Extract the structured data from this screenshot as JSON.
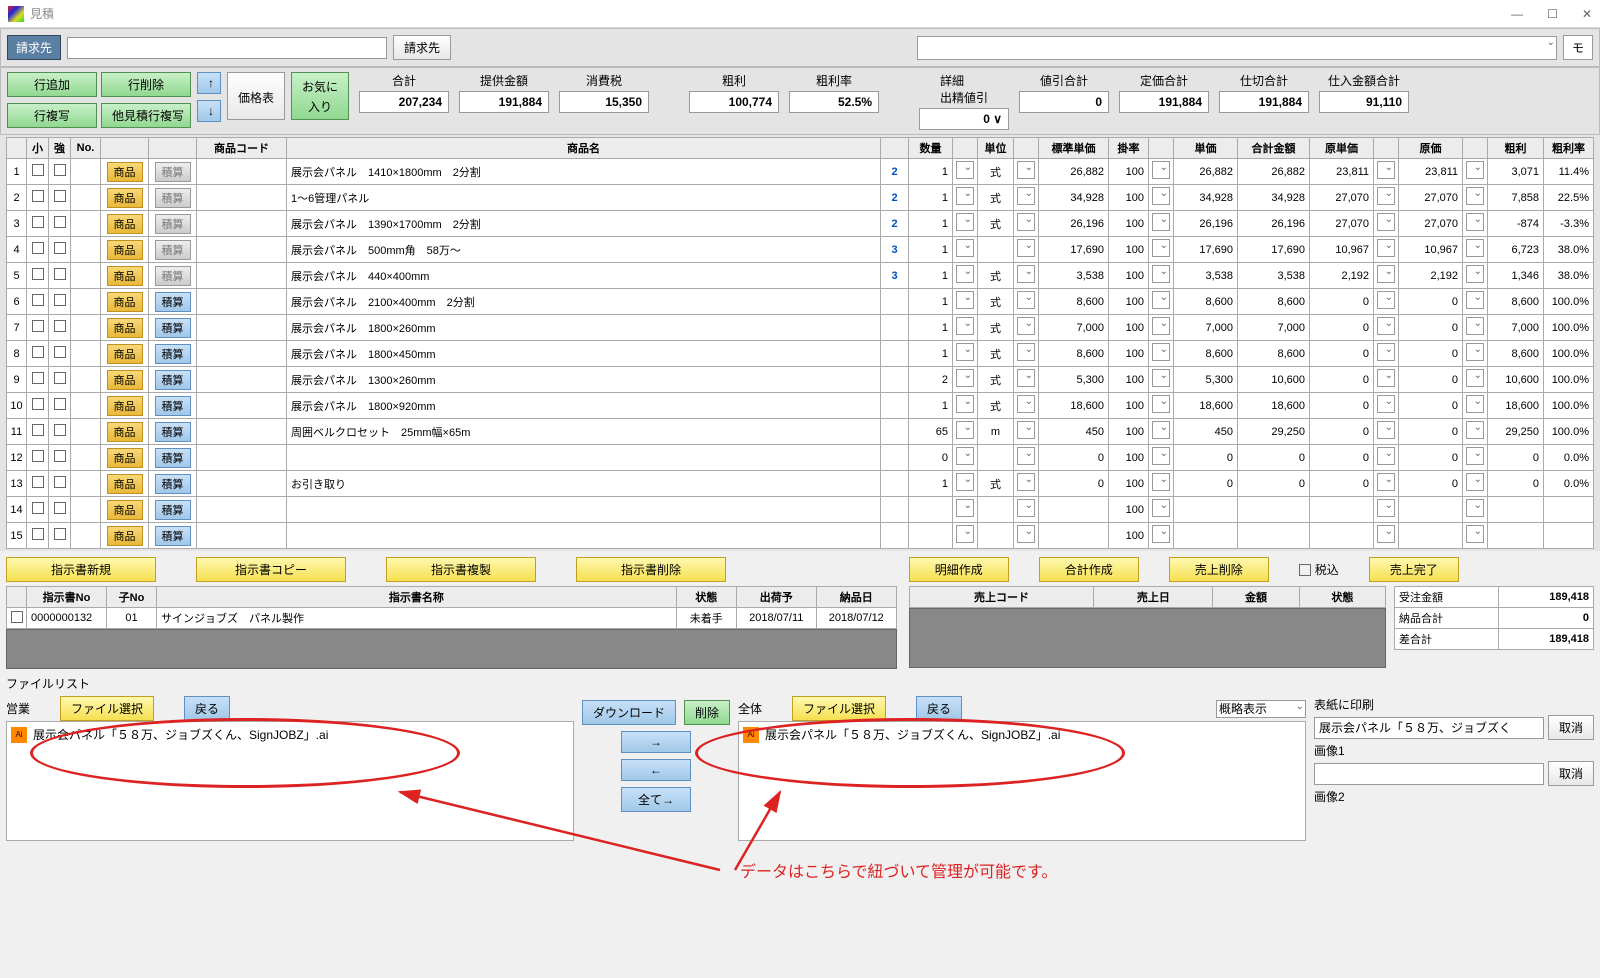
{
  "window": {
    "title": "見積",
    "min": "—",
    "max": "☐",
    "close": "✕"
  },
  "top": {
    "billing_btn": "請求先",
    "big_dropdown": "",
    "mo": "モ",
    "row_add": "行追加",
    "row_del": "行削除",
    "row_copy": "行複写",
    "other_copy": "他見積行複写",
    "up": "↑",
    "down": "↓",
    "price_table": "価格表",
    "favorite": "お気に\n入り"
  },
  "totals": {
    "sum_lbl": "合計",
    "offer_lbl": "提供金額",
    "tax_lbl": "消費税",
    "gp_lbl": "粗利",
    "gpr_lbl": "粗利率",
    "detail_lbl": "詳細",
    "detail2_lbl": "出精値引",
    "disc_lbl": "値引合計",
    "list_lbl": "定価合計",
    "cost_lbl": "仕切合計",
    "purchase_lbl": "仕入金額合計",
    "offer": "207,234",
    "offer2": "191,884",
    "tax": "15,350",
    "gp": "100,774",
    "gpr": "52.5%",
    "detail_val": "0 ∨",
    "disc": "0",
    "list": "191,884",
    "cost": "191,884",
    "purchase": "91,110"
  },
  "grid": {
    "headers": [
      "",
      "小",
      "強",
      "No.",
      "",
      "",
      "商品コード",
      "商品名",
      "",
      "数量",
      "",
      "単位",
      "",
      "標準単価",
      "掛率",
      "",
      "単価",
      "合計金額",
      "原単価",
      "",
      "原価",
      "",
      "粗利",
      "粗利率"
    ],
    "rows": [
      {
        "n": 1,
        "name": "展示会パネル　1410×1800mm　2分割",
        "link": "2",
        "qty": "1",
        "unit": "式",
        "stdp": "26,882",
        "rate": "100",
        "up": "26,882",
        "tot": "26,882",
        "cu": "23,811",
        "cost": "23,811",
        "gp": "3,071",
        "gpr": "11.4%",
        "calc": "gray"
      },
      {
        "n": 2,
        "name": "1～6管理パネル",
        "link": "2",
        "qty": "1",
        "unit": "式",
        "stdp": "34,928",
        "rate": "100",
        "up": "34,928",
        "tot": "34,928",
        "cu": "27,070",
        "cost": "27,070",
        "gp": "7,858",
        "gpr": "22.5%",
        "calc": "gray"
      },
      {
        "n": 3,
        "name": "展示会パネル　1390×1700mm　2分割",
        "link": "2",
        "qty": "1",
        "unit": "式",
        "stdp": "26,196",
        "rate": "100",
        "up": "26,196",
        "tot": "26,196",
        "cu": "27,070",
        "cost": "27,070",
        "gp": "-874",
        "gpr": "-3.3%",
        "calc": "gray"
      },
      {
        "n": 4,
        "name": "展示会パネル　500mm角　58万～",
        "link": "3",
        "qty": "1",
        "unit": "",
        "stdp": "17,690",
        "rate": "100",
        "up": "17,690",
        "tot": "17,690",
        "cu": "10,967",
        "cost": "10,967",
        "gp": "6,723",
        "gpr": "38.0%",
        "calc": "gray"
      },
      {
        "n": 5,
        "name": "展示会パネル　440×400mm",
        "link": "3",
        "qty": "1",
        "unit": "式",
        "stdp": "3,538",
        "rate": "100",
        "up": "3,538",
        "tot": "3,538",
        "cu": "2,192",
        "cost": "2,192",
        "gp": "1,346",
        "gpr": "38.0%",
        "calc": "gray"
      },
      {
        "n": 6,
        "name": "展示会パネル　2100×400mm　2分割",
        "link": "",
        "qty": "1",
        "unit": "式",
        "stdp": "8,600",
        "rate": "100",
        "up": "8,600",
        "tot": "8,600",
        "cu": "0",
        "cost": "0",
        "gp": "8,600",
        "gpr": "100.0%",
        "calc": "blue"
      },
      {
        "n": 7,
        "name": "展示会パネル　1800×260mm",
        "link": "",
        "qty": "1",
        "unit": "式",
        "stdp": "7,000",
        "rate": "100",
        "up": "7,000",
        "tot": "7,000",
        "cu": "0",
        "cost": "0",
        "gp": "7,000",
        "gpr": "100.0%",
        "calc": "blue"
      },
      {
        "n": 8,
        "name": "展示会パネル　1800×450mm",
        "link": "",
        "qty": "1",
        "unit": "式",
        "stdp": "8,600",
        "rate": "100",
        "up": "8,600",
        "tot": "8,600",
        "cu": "0",
        "cost": "0",
        "gp": "8,600",
        "gpr": "100.0%",
        "calc": "blue"
      },
      {
        "n": 9,
        "name": "展示会パネル　1300×260mm",
        "link": "",
        "qty": "2",
        "unit": "式",
        "stdp": "5,300",
        "rate": "100",
        "up": "5,300",
        "tot": "10,600",
        "cu": "0",
        "cost": "0",
        "gp": "10,600",
        "gpr": "100.0%",
        "calc": "blue"
      },
      {
        "n": 10,
        "name": "展示会パネル　1800×920mm",
        "link": "",
        "qty": "1",
        "unit": "式",
        "stdp": "18,600",
        "rate": "100",
        "up": "18,600",
        "tot": "18,600",
        "cu": "0",
        "cost": "0",
        "gp": "18,600",
        "gpr": "100.0%",
        "calc": "blue"
      },
      {
        "n": 11,
        "name": "周囲ベルクロセット　25mm幅×65m",
        "link": "",
        "qty": "65",
        "unit": "m",
        "stdp": "450",
        "rate": "100",
        "up": "450",
        "tot": "29,250",
        "cu": "0",
        "cost": "0",
        "gp": "29,250",
        "gpr": "100.0%",
        "calc": "blue"
      },
      {
        "n": 12,
        "name": "",
        "link": "",
        "qty": "0",
        "unit": "",
        "stdp": "0",
        "rate": "100",
        "up": "0",
        "tot": "0",
        "cu": "0",
        "cost": "0",
        "gp": "0",
        "gpr": "0.0%",
        "calc": "blue"
      },
      {
        "n": 13,
        "name": "お引き取り",
        "link": "",
        "qty": "1",
        "unit": "式",
        "stdp": "0",
        "rate": "100",
        "up": "0",
        "tot": "0",
        "cu": "0",
        "cost": "0",
        "gp": "0",
        "gpr": "0.0%",
        "calc": "blue"
      },
      {
        "n": 14,
        "name": "",
        "link": "",
        "qty": "",
        "unit": "",
        "stdp": "",
        "rate": "100",
        "up": "",
        "tot": "",
        "cu": "",
        "cost": "",
        "gp": "",
        "gpr": "",
        "calc": "blue"
      },
      {
        "n": 15,
        "name": "",
        "link": "",
        "qty": "",
        "unit": "",
        "stdp": "",
        "rate": "100",
        "up": "",
        "tot": "",
        "cu": "",
        "cost": "",
        "gp": "",
        "gpr": "",
        "calc": "blue"
      }
    ],
    "prod_btn": "商品",
    "calc_btn": "積算"
  },
  "instr": {
    "new": "指示書新規",
    "copy": "指示書コピー",
    "dup": "指示書複製",
    "del": "指示書削除",
    "headers": [
      "",
      "指示書No",
      "子No",
      "指示書名称",
      "状態",
      "出荷予",
      "納品日"
    ],
    "row": {
      "no": "0000000132",
      "sub": "01",
      "name": "サインジョブズ　パネル製作",
      "state": "未着手",
      "ship": "2018/07/11",
      "deliv": "2018/07/12"
    }
  },
  "sales": {
    "detail": "明細作成",
    "sum": "合計作成",
    "del": "売上削除",
    "tax_chk": "税込",
    "done": "売上完了",
    "headers": [
      "売上コード",
      "売上日",
      "金額",
      "状態"
    ],
    "ord_lbl": "受注金額",
    "ord": "189,418",
    "deliv_lbl": "納品合計",
    "deliv": "0",
    "diff_lbl": "差合計",
    "diff": "189,418"
  },
  "files": {
    "title": "ファイルリスト",
    "select": "ファイル選択",
    "back": "戻る",
    "download": "ダウンロード",
    "delete": "削除",
    "summary": "概略表示",
    "left_lbl": "営業",
    "right_lbl": "全体",
    "fname": "展示会パネル「５８万、ジョブズくん、SignJOBZ」.ai",
    "right": "→",
    "left": "←",
    "all": "全て→",
    "print_lbl": "表紙に印刷",
    "img1": "画像1",
    "img2": "画像2",
    "cancel": "取消",
    "print_val": "展示会パネル「５８万、ジョブズく"
  },
  "annotation": "データはこちらで紐づいて管理が可能です。"
}
